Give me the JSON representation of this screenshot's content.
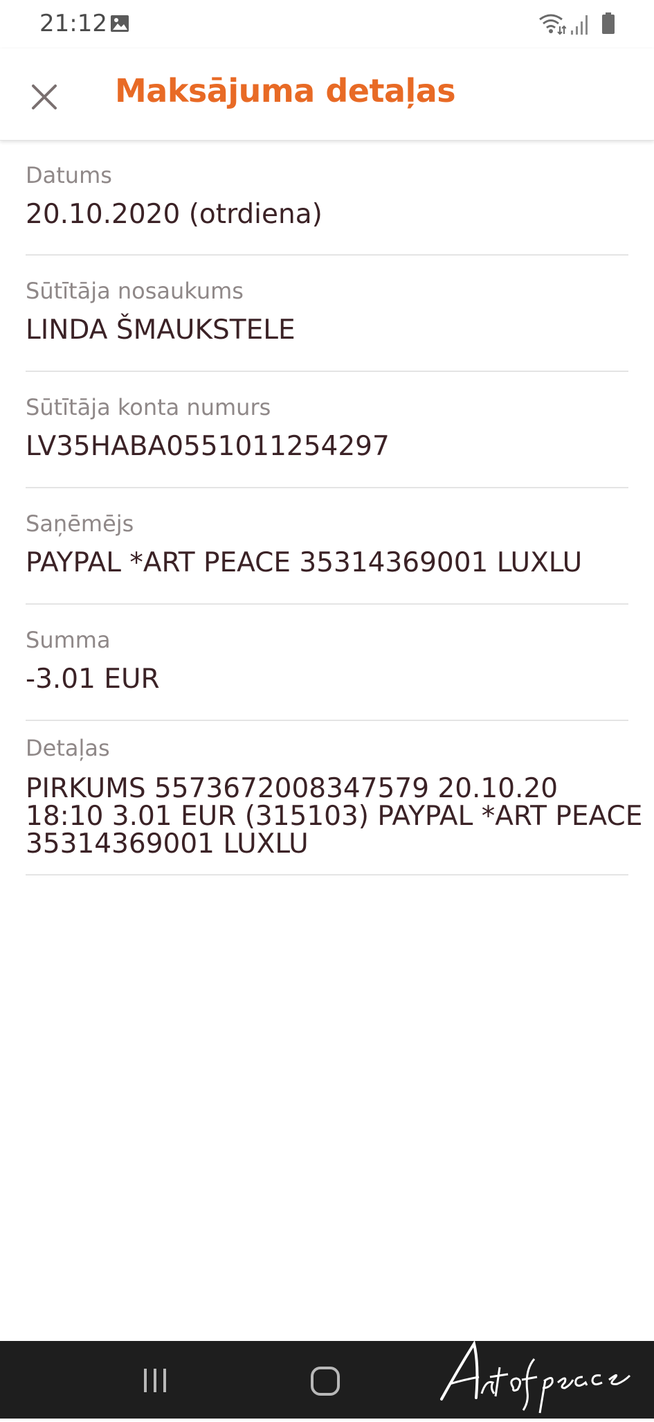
{
  "status_bar": {
    "time": "21:12",
    "icons": [
      "image-icon",
      "wifi-icon",
      "signal-icon",
      "battery-icon"
    ]
  },
  "header": {
    "title": "Maksājuma detaļas",
    "close_icon": "close-icon",
    "title_color": "#e86a25"
  },
  "details": {
    "date": {
      "label": "Datums",
      "value": "20.10.2020 (otrdiena)"
    },
    "sender_name": {
      "label": "Sūtītāja nosaukums",
      "value": "LINDA ŠMAUKSTELE"
    },
    "sender_account": {
      "label": "Sūtītāja konta numurs",
      "value": "LV35HABA0551011254297"
    },
    "recipient": {
      "label": "Saņēmējs",
      "value": "PAYPAL *ART PEACE 35314369001 LUXLU"
    },
    "amount": {
      "label": "Summa",
      "value": "-3.01 EUR"
    },
    "details": {
      "label": "Detaļas",
      "value_line1": "PIRKUMS 5573672008347579 20.10.20",
      "value_line2": "18:10 3.01 EUR (315103) PAYPAL *ART PEACE",
      "value_line3": "35314369001 LUXLU"
    }
  },
  "nav_bar": {
    "icons": [
      "recents-icon",
      "home-icon"
    ]
  },
  "watermark": {
    "text": "Art of peace"
  }
}
